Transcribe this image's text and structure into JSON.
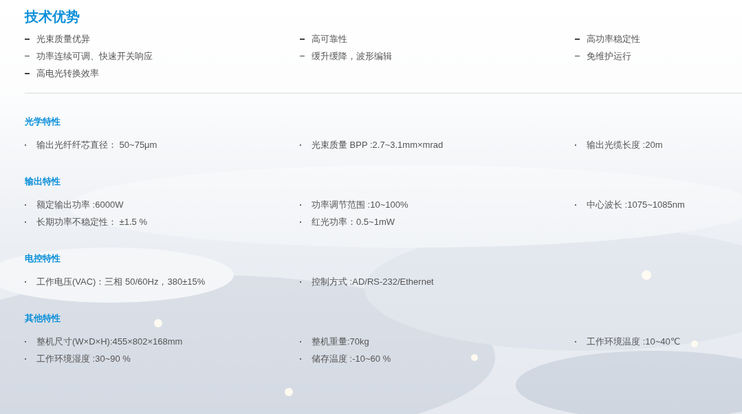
{
  "title": "技术优势",
  "advantages": [
    "光束质量优异",
    "高可靠性",
    "高功率稳定性",
    "功率连续可调、快速开关响应",
    "缓升缓降，波形编辑",
    "免维护运行",
    "高电光转换效率"
  ],
  "sections": [
    {
      "title": "光学特性",
      "items": [
        "输出光纤纤芯直径： 50~75μm",
        "光束质量 BPP :2.7~3.1mm×mrad",
        "输出光缆长度 :20m"
      ]
    },
    {
      "title": "输出特性",
      "items": [
        "额定输出功率 :6000W",
        "功率调节范围 :10~100%",
        "中心波长 :1075~1085nm",
        "长期功率不稳定性： ±1.5 %",
        "红光功率：0.5~1mW"
      ]
    },
    {
      "title": "电控特性",
      "items": [
        "工作电压(VAC)：三相 50/60Hz，380±15%",
        "控制方式 :AD/RS-232/Ethernet"
      ]
    },
    {
      "title": "其他特性",
      "items": [
        "整机尺寸(W×D×H):455×802×168mm",
        "整机重量:70kg",
        "工作环境温度 :10~40℃",
        "工作环境湿度 :30~90 %",
        "储存温度 :-10~60 %"
      ]
    }
  ]
}
